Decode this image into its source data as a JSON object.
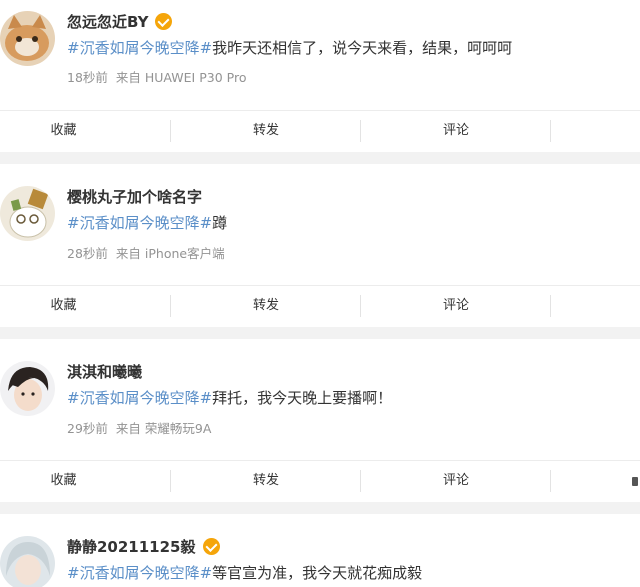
{
  "posts": [
    {
      "username": "忽远忽近BY",
      "verified": true,
      "topic": "#沉香如屑今晚空降#",
      "text": "我昨天还相信了，说今天来看，结果，呵呵呵",
      "time": "18秒前",
      "source": "来自 HUAWEI P30 Pro"
    },
    {
      "username": "樱桃丸子加个啥名字",
      "verified": false,
      "topic": "#沉香如屑今晚空降#",
      "text": "蹲",
      "time": "28秒前",
      "source": "来自 iPhone客户端"
    },
    {
      "username": "淇淇和曦曦",
      "verified": false,
      "topic": "#沉香如屑今晚空降#",
      "text": "拜托，我今天晚上要播啊！",
      "time": "29秒前",
      "source": "来自 荣耀畅玩9A"
    },
    {
      "username": "静静20211125毅",
      "verified": true,
      "topic": "#沉香如屑今晚空降#",
      "text": "等官宣为准，我今天就花痴成毅",
      "time": "",
      "source": ""
    }
  ],
  "actions": {
    "favorite": "收藏",
    "repost": "转发",
    "comment": "评论"
  },
  "colors": {
    "topic": "#5b8fc8",
    "verified_badge": "#f5a50a",
    "meta": "#939393"
  }
}
